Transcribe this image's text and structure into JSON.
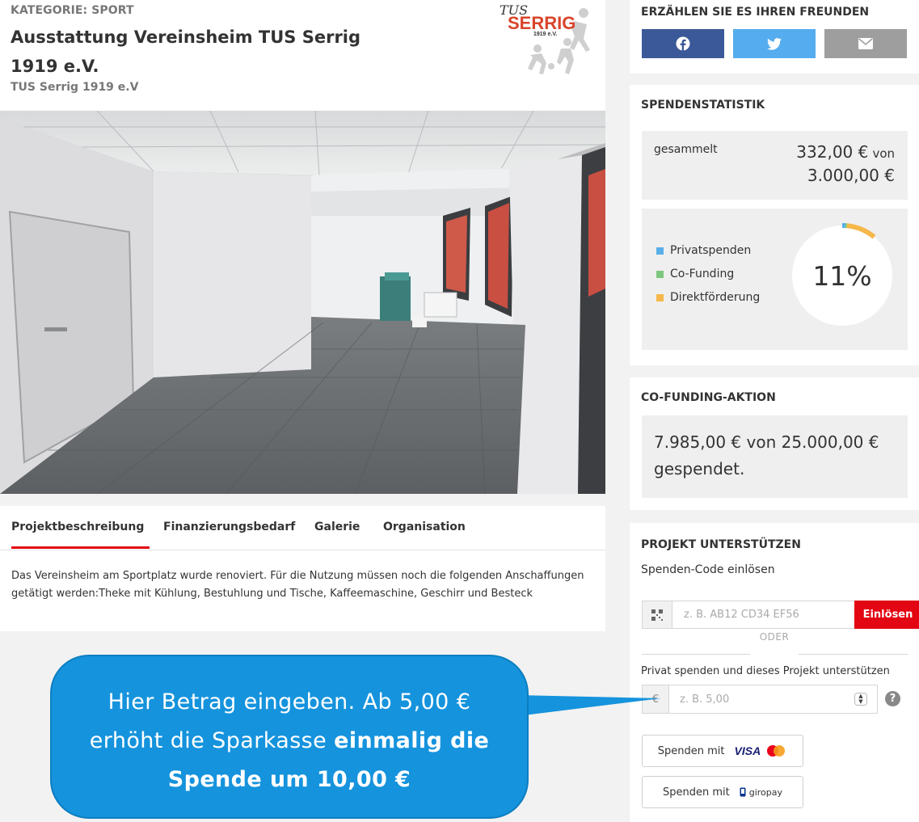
{
  "project": {
    "category": "KATEGORIE: SPORT",
    "title": "Ausstattung Vereinsheim TUS Serrig 1919 e.V.",
    "organization": "TUS Serrig 1919 e.V",
    "logo": {
      "line1": "TUS",
      "line2": "SERRIG",
      "line3": "1919 e.V."
    }
  },
  "tabs": [
    {
      "label": "Projektbeschreibung",
      "active": true
    },
    {
      "label": "Finanzierungsbedarf",
      "active": false
    },
    {
      "label": "Galerie",
      "active": false
    },
    {
      "label": "Organisation",
      "active": false
    }
  ],
  "description": "Das Vereinsheim am Sportplatz wurde renoviert. Für die Nutzung müssen noch die folgenden Anschaffungen getätigt werden:Theke mit Kühlung, Bestuhlung und Tische, Kaffeemaschine,  Geschirr und Besteck",
  "share": {
    "heading": "ERZÄHLEN SIE ES IHREN FREUNDEN",
    "buttons": [
      {
        "icon": "facebook-icon",
        "color": "#3b5998"
      },
      {
        "icon": "twitter-icon",
        "color": "#55acee"
      },
      {
        "icon": "email-icon",
        "color": "#9e9e9e"
      }
    ]
  },
  "stats": {
    "heading": "SPENDENSTATISTIK",
    "collected_label": "gesammelt",
    "collected_amount": "332,00 €",
    "von": "von",
    "goal_amount": "3.000,00 €",
    "percent_label": "11%",
    "percent_value": 11,
    "legend": [
      {
        "label": "Privatspenden",
        "color": "#5aaee8",
        "share_percent": 1
      },
      {
        "label": "Co-Funding",
        "color": "#7dc77d",
        "share_percent": 0.5
      },
      {
        "label": "Direktförderung",
        "color": "#f7b84b",
        "share_percent": 9.5
      }
    ]
  },
  "cofunding": {
    "heading": "CO-FUNDING-AKTION",
    "text": "7.985,00 € von 25.000,00 € gespendet."
  },
  "support": {
    "heading": "PROJEKT UNTERSTÜTZEN",
    "code_label": "Spenden-Code einlösen",
    "code_placeholder": "z. B. AB12 CD34 EF56",
    "redeem_label": "Einlösen",
    "oder": "ODER",
    "private_label": "Privat spenden und dieses Projekt unterstützen",
    "currency": "€",
    "amount_placeholder": "z. B. 5,00",
    "help": "?",
    "pay_prefix": "Spenden mit",
    "visa": "VISA",
    "giropay": "giropay"
  },
  "callout": {
    "line1": "Hier Betrag eingeben. Ab 5,00 €",
    "line2_a": "erhöht die Sparkasse ",
    "line2_b": "einmalig die",
    "line3": "Spende um 10,00 €"
  }
}
